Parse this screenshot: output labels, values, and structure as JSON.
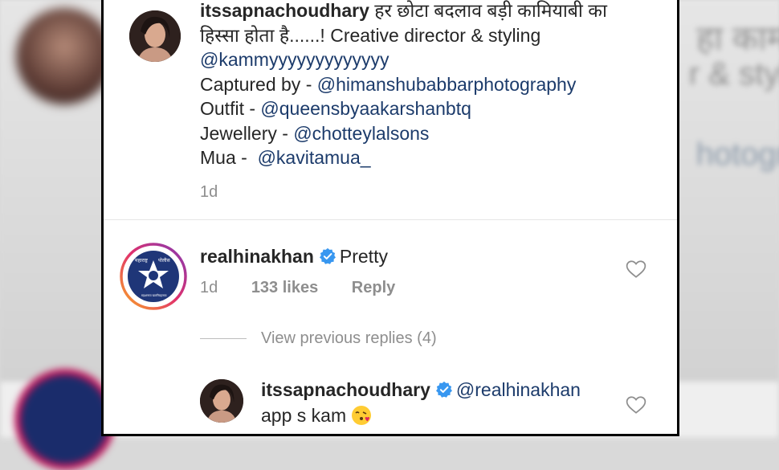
{
  "post": {
    "username": "itssapnachoudhary",
    "caption_text": "हर छोटा बदलाव बड़ी कामियाबी का हिस्सा होता है......! Creative director & styling",
    "caption_mention": "@kammyyyyyyyyyyyyy",
    "captured_label": "Captured by - ",
    "captured_handle": "@himanshubabbarphotography",
    "outfit_label": "Outfit - ",
    "outfit_handle": "@queensbyaakarshanbtq",
    "jewellery_label": "Jewellery - ",
    "jewellery_handle": "@chotteylalsons",
    "mua_label": "Mua -  ",
    "mua_handle": "@kavitamua_",
    "time": "1d"
  },
  "comment": {
    "username": "realhinakhan",
    "text": "Pretty",
    "time": "1d",
    "likes": "133 likes",
    "reply_label": "Reply",
    "avatar_icon": "maharashtra-police-logo",
    "avatar_text_left": "महाराष्ट्र",
    "avatar_text_right": "पोलीस",
    "avatar_motto": "सद्रक्षणाय खलनिग्रहणाय"
  },
  "view_replies": "View previous replies (4)",
  "reply": {
    "username": "itssapnachoudhary",
    "mention": "@realhinakhan",
    "text": "app s kam",
    "emoji": "face-blowing-kiss-emoji"
  },
  "colors": {
    "link": "#1c3b6b",
    "verified": "#3897f0",
    "muted": "#8e8e8e",
    "text": "#262626"
  }
}
